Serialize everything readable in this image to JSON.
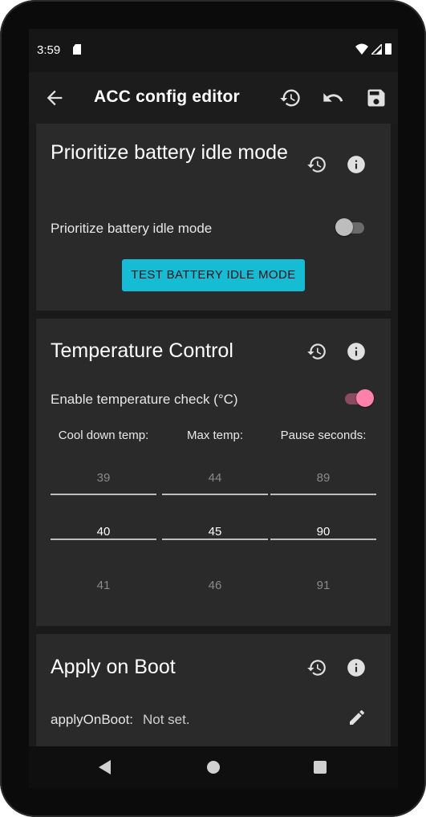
{
  "status_bar": {
    "time": "3:59"
  },
  "app_bar": {
    "title": "ACC config editor"
  },
  "cards": {
    "idle": {
      "title": "Prioritize battery idle mode",
      "toggle_label": "Prioritize battery idle mode",
      "toggle_on": false,
      "button_label": "TEST BATTERY IDLE MODE"
    },
    "temp": {
      "title": "Temperature Control",
      "toggle_label": "Enable temperature check (°C)",
      "toggle_on": true,
      "pickers": [
        {
          "header": "Cool down temp:",
          "above": "39",
          "selected": "40",
          "below": "41"
        },
        {
          "header": "Max temp:",
          "above": "44",
          "selected": "45",
          "below": "46"
        },
        {
          "header": "Pause seconds:",
          "above": "89",
          "selected": "90",
          "below": "91"
        }
      ]
    },
    "boot": {
      "title": "Apply on Boot",
      "key": "applyOnBoot:",
      "value": "Not set."
    }
  },
  "colors": {
    "accent_button": "#16bcd4",
    "switch_on_thumb": "#ff80ab",
    "switch_off_thumb": "#bdbdbd",
    "card_background": "#2a2a2a"
  }
}
